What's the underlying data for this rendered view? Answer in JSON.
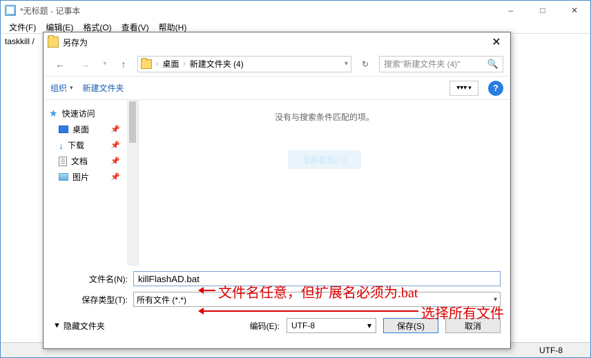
{
  "notepad": {
    "title": "*无标题 - 记事本",
    "menu": [
      "文件(F)",
      "编辑(E)",
      "格式(O)",
      "查看(V)",
      "帮助(H)"
    ],
    "body": "taskkill /",
    "status_encoding": "UTF-8"
  },
  "dialog": {
    "title": "另存为",
    "path": {
      "segments": [
        "桌面",
        "新建文件夹 (4)"
      ]
    },
    "search_placeholder": "搜索\"新建文件夹 (4)\"",
    "toolbar": {
      "organize": "组织",
      "newfolder": "新建文件夹"
    },
    "tree": {
      "quick": "快速访问",
      "desktop": "桌面",
      "downloads": "下载",
      "documents": "文档",
      "pictures": "图片"
    },
    "files": {
      "empty": "没有与搜索条件匹配的项。",
      "ghost": "全屏截图(S)"
    },
    "form": {
      "filename_label": "文件名(N):",
      "filename_value": "killFlashAD.bat",
      "type_label": "保存类型(T):",
      "type_value": "所有文件 (*.*)"
    },
    "actions": {
      "hidden": "隐藏文件夹",
      "encoding_label": "编码(E):",
      "encoding_value": "UTF-8",
      "save": "保存(S)",
      "cancel": "取消"
    }
  },
  "annotations": {
    "filename_note": "文件名任意，但扩展名必须为.bat",
    "type_note": "选择所有文件"
  }
}
